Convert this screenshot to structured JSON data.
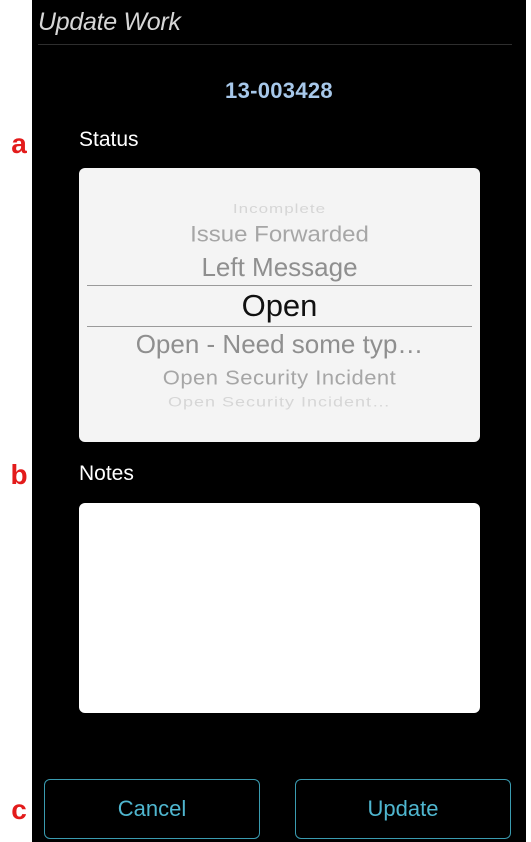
{
  "annotations": {
    "a": "a",
    "b": "b",
    "c": "c"
  },
  "header": {
    "title": "Update Work",
    "work_id": "13-003428"
  },
  "status": {
    "label": "Status",
    "options": [
      "Incomplete",
      "Issue Forwarded",
      "Left Message",
      "Open",
      "Open - Need some typ…",
      "Open Security Incident",
      "Open Security Incident…"
    ],
    "selected": "Open"
  },
  "notes": {
    "label": "Notes",
    "value": ""
  },
  "buttons": {
    "cancel": "Cancel",
    "update": "Update"
  },
  "colors": {
    "accent": "#4fb6cf",
    "id_text": "#a7c8ea",
    "annotation": "#e31b1b",
    "background": "#000000"
  }
}
